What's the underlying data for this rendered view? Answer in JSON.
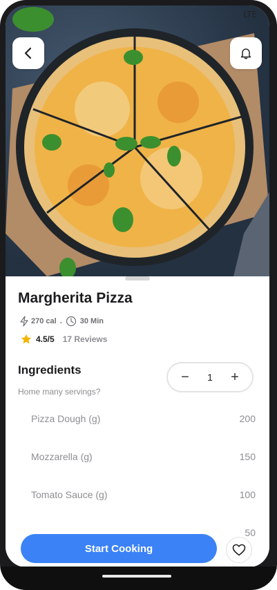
{
  "status_bar": {
    "network": "LTE"
  },
  "recipe": {
    "title": "Margherita Pizza",
    "calories": "270 cal",
    "separator": ".",
    "time": "30 Min",
    "rating": "4.5/5",
    "reviews": "17 Reviews"
  },
  "ingredients": {
    "title": "Ingredients",
    "servings_prompt": "Home many servings?",
    "servings": "1",
    "minus": "−",
    "plus": "+",
    "items": [
      {
        "name": "Pizza Dough (g)",
        "amount": "200"
      },
      {
        "name": "Mozzarella (g)",
        "amount": "150"
      },
      {
        "name": "Tomato Sauce (g)",
        "amount": "100"
      },
      {
        "name": "",
        "amount": "50"
      }
    ]
  },
  "actions": {
    "start_cooking": "Start Cooking"
  },
  "colors": {
    "accent": "#3b82f6",
    "star": "#f5b400"
  },
  "icons": {
    "back": "chevron-left-icon",
    "bell": "bell-icon",
    "calories": "bolt-icon",
    "time": "clock-icon",
    "star": "star-icon",
    "favorite": "heart-icon"
  }
}
